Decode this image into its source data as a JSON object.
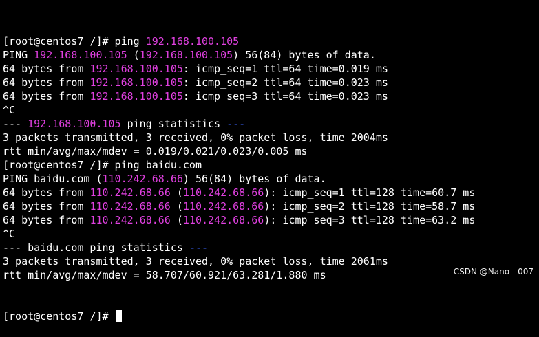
{
  "colors": {
    "background": "#000000",
    "text": "#ffffff",
    "highlight_magenta": "#e040e0",
    "highlight_blue": "#3a63ff"
  },
  "terminal": {
    "lines": [
      [
        {
          "t": "[root@centos7 /]# ping "
        },
        {
          "t": "192.168.100.105",
          "c": "magenta"
        }
      ],
      [
        {
          "t": "PING "
        },
        {
          "t": "192.168.100.105",
          "c": "magenta"
        },
        {
          "t": " ("
        },
        {
          "t": "192.168.100.105",
          "c": "magenta"
        },
        {
          "t": ") 56(84) bytes of data."
        }
      ],
      [
        {
          "t": "64 bytes from "
        },
        {
          "t": "192.168.100.105",
          "c": "magenta"
        },
        {
          "t": ": icmp_seq=1 ttl=64 time=0.019 ms"
        }
      ],
      [
        {
          "t": "64 bytes from "
        },
        {
          "t": "192.168.100.105",
          "c": "magenta"
        },
        {
          "t": ": icmp_seq=2 ttl=64 time=0.023 ms"
        }
      ],
      [
        {
          "t": "64 bytes from "
        },
        {
          "t": "192.168.100.105",
          "c": "magenta"
        },
        {
          "t": ": icmp_seq=3 ttl=64 time=0.023 ms"
        }
      ],
      [
        {
          "t": "^C"
        }
      ],
      [
        {
          "t": "--- "
        },
        {
          "t": "192.168.100.105",
          "c": "magenta"
        },
        {
          "t": " ping statistics "
        },
        {
          "t": "---",
          "c": "blue"
        }
      ],
      [
        {
          "t": "3 packets transmitted, 3 received, 0% packet loss, time 2004ms"
        }
      ],
      [
        {
          "t": "rtt min/avg/max/mdev = 0.019/0.021/0.023/0.005 ms"
        }
      ],
      [
        {
          "t": "[root@centos7 /]# ping baidu.com"
        }
      ],
      [
        {
          "t": "PING baidu.com ("
        },
        {
          "t": "110.242.68.66",
          "c": "magenta"
        },
        {
          "t": ") 56(84) bytes of data."
        }
      ],
      [
        {
          "t": "64 bytes from "
        },
        {
          "t": "110.242.68.66",
          "c": "magenta"
        },
        {
          "t": " ("
        },
        {
          "t": "110.242.68.66",
          "c": "magenta"
        },
        {
          "t": "): icmp_seq=1 ttl=128 time=60.7 ms"
        }
      ],
      [
        {
          "t": "64 bytes from "
        },
        {
          "t": "110.242.68.66",
          "c": "magenta"
        },
        {
          "t": " ("
        },
        {
          "t": "110.242.68.66",
          "c": "magenta"
        },
        {
          "t": "): icmp_seq=2 ttl=128 time=58.7 ms"
        }
      ],
      [
        {
          "t": "64 bytes from "
        },
        {
          "t": "110.242.68.66",
          "c": "magenta"
        },
        {
          "t": " ("
        },
        {
          "t": "110.242.68.66",
          "c": "magenta"
        },
        {
          "t": "): icmp_seq=3 ttl=128 time=63.2 ms"
        }
      ],
      [
        {
          "t": "^C"
        }
      ],
      [
        {
          "t": "--- baidu.com ping statistics "
        },
        {
          "t": "---",
          "c": "blue"
        }
      ],
      [
        {
          "t": "3 packets transmitted, 3 received, 0% packet loss, time 2061ms"
        }
      ],
      [
        {
          "t": "rtt min/avg/max/mdev = 58.707/60.921/63.281/1.880 ms"
        }
      ]
    ],
    "prompt": "[root@centos7 /]# "
  },
  "watermark": "CSDN @Nano__007"
}
